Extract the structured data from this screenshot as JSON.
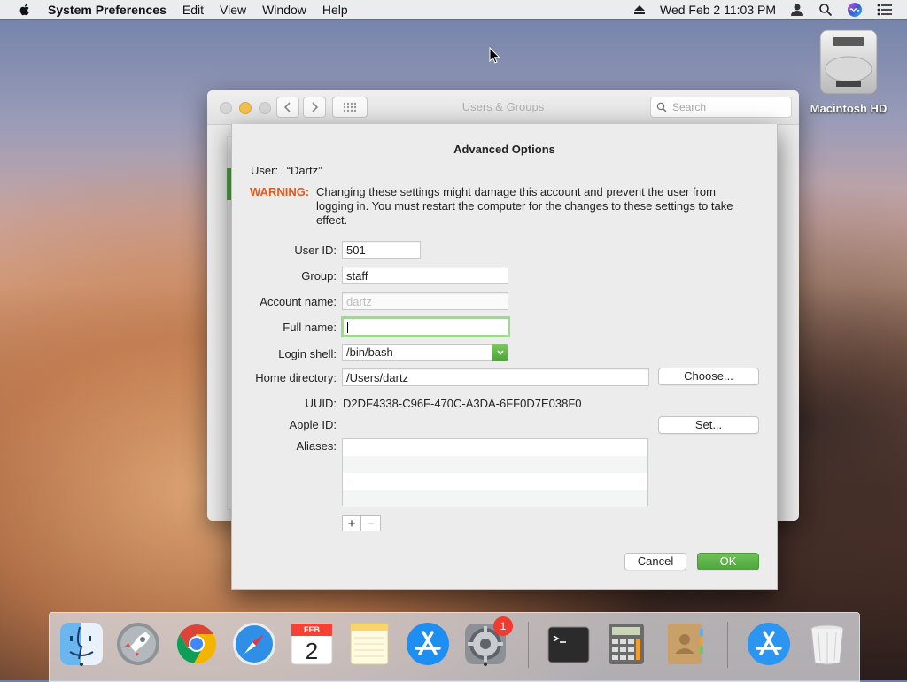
{
  "menubar": {
    "app_name": "System Preferences",
    "menus": [
      "Edit",
      "View",
      "Window",
      "Help"
    ],
    "clock": "Wed Feb 2  11:03 PM"
  },
  "desktop": {
    "disk_label": "Macintosh HD"
  },
  "window": {
    "title": "Users & Groups",
    "search_placeholder": "Search"
  },
  "sheet": {
    "title": "Advanced Options",
    "user_label": "User:",
    "user_value": "“Dartz”",
    "warning_label": "WARNING:",
    "warning_text": "Changing these settings might damage this account and prevent the user from logging in. You must restart the computer for the changes to these settings to take effect.",
    "fields": {
      "user_id_label": "User ID:",
      "user_id": "501",
      "group_label": "Group:",
      "group": "staff",
      "account_name_label": "Account name:",
      "account_name": "dartz",
      "full_name_label": "Full name:",
      "full_name": "",
      "login_shell_label": "Login shell:",
      "login_shell": "/bin/bash",
      "home_directory_label": "Home directory:",
      "home_directory": "/Users/dartz",
      "uuid_label": "UUID:",
      "uuid": "D2DF4338-C96F-470C-A3DA-6FF0D7E038F0",
      "apple_id_label": "Apple ID:",
      "aliases_label": "Aliases:"
    },
    "buttons": {
      "choose": "Choose...",
      "set": "Set...",
      "add": "+",
      "remove": "−",
      "cancel": "Cancel",
      "ok": "OK"
    }
  },
  "dock": {
    "calendar_month": "FEB",
    "calendar_day": "2",
    "sysprefs_badge": "1"
  },
  "colors": {
    "warning": "#e05a1f",
    "ok_button": "#4fa43c",
    "focus_ring": "#9fd88f"
  }
}
